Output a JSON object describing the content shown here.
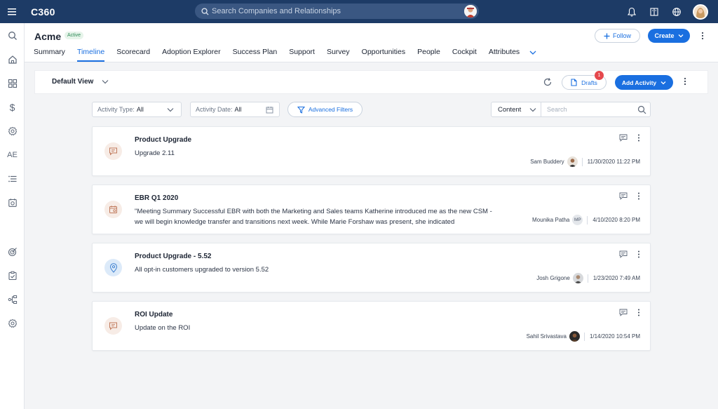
{
  "app": {
    "brand": "C360",
    "search_placeholder": "Search Companies and Relationships"
  },
  "left_nav": {
    "items": [
      {
        "name": "search-nav-icon"
      },
      {
        "name": "home-nav-icon"
      },
      {
        "name": "dashboard-nav-icon"
      },
      {
        "name": "dollar-nav-icon"
      },
      {
        "name": "settings-gear-nav-icon"
      },
      {
        "name": "ae-nav-label",
        "label": "AE"
      },
      {
        "name": "list-nav-icon"
      },
      {
        "name": "calendar-nav-icon"
      },
      {
        "name": "target-nav-icon"
      },
      {
        "name": "checklist-nav-icon"
      },
      {
        "name": "hierarchy-nav-icon"
      },
      {
        "name": "admin-gear-nav-icon"
      }
    ]
  },
  "company": {
    "name": "Acme",
    "status": "Active",
    "follow_label": "Follow",
    "create_label": "Create"
  },
  "tabs": [
    {
      "label": "Summary",
      "active": false
    },
    {
      "label": "Timeline",
      "active": true
    },
    {
      "label": "Scorecard",
      "active": false
    },
    {
      "label": "Adoption Explorer",
      "active": false
    },
    {
      "label": "Success Plan",
      "active": false
    },
    {
      "label": "Support",
      "active": false
    },
    {
      "label": "Survey",
      "active": false
    },
    {
      "label": "Opportunities",
      "active": false
    },
    {
      "label": "People",
      "active": false
    },
    {
      "label": "Cockpit",
      "active": false
    },
    {
      "label": "Attributes",
      "active": false
    }
  ],
  "viewbar": {
    "view_label": "Default View",
    "drafts_label": "Drafts",
    "drafts_count": "1",
    "add_activity_label": "Add Activity"
  },
  "filters": {
    "activity_type_label": "Activity Type:",
    "activity_type_value": "All",
    "activity_date_label": "Activity Date:",
    "activity_date_value": "All",
    "advanced_filters_label": "Advanced Filters",
    "content_select": "Content",
    "search_placeholder": "Search"
  },
  "activities": [
    {
      "title": "Product Upgrade",
      "body": "Upgrade 2.11",
      "author": "Sam Buddery",
      "date": "11/30/2020 11:22 PM",
      "icon": "chat-note-icon",
      "avatar_initials": ""
    },
    {
      "title": "EBR Q1 2020",
      "body": "\"Meeting Summary Successful EBR with both the Marketing and Sales teams Katherine introduced me as the new CSM - we will begin knowledge transfer and transitions next week. While Marie Forshaw was present, she indicated",
      "author": "Mounika Patha",
      "date": "4/10/2020 8:20 PM",
      "icon": "calendar-meeting-icon",
      "avatar_initials": "MP"
    },
    {
      "title": "Product Upgrade - 5.52",
      "body": "All opt-in customers upgraded to version 5.52",
      "author": "Josh Grigone",
      "date": "1/23/2020 7:49 AM",
      "icon": "location-pin-icon",
      "avatar_initials": ""
    },
    {
      "title": "ROI Update",
      "body": "Update on the ROI",
      "author": "Sahil Srivastava",
      "date": "1/14/2020 10:54 PM",
      "icon": "chat-note-icon",
      "avatar_initials": ""
    }
  ],
  "colors": {
    "topbar": "#1d3b66",
    "accent": "#1a6fe0",
    "badge_red": "#e5484d",
    "active_green": "#2e8b57"
  }
}
